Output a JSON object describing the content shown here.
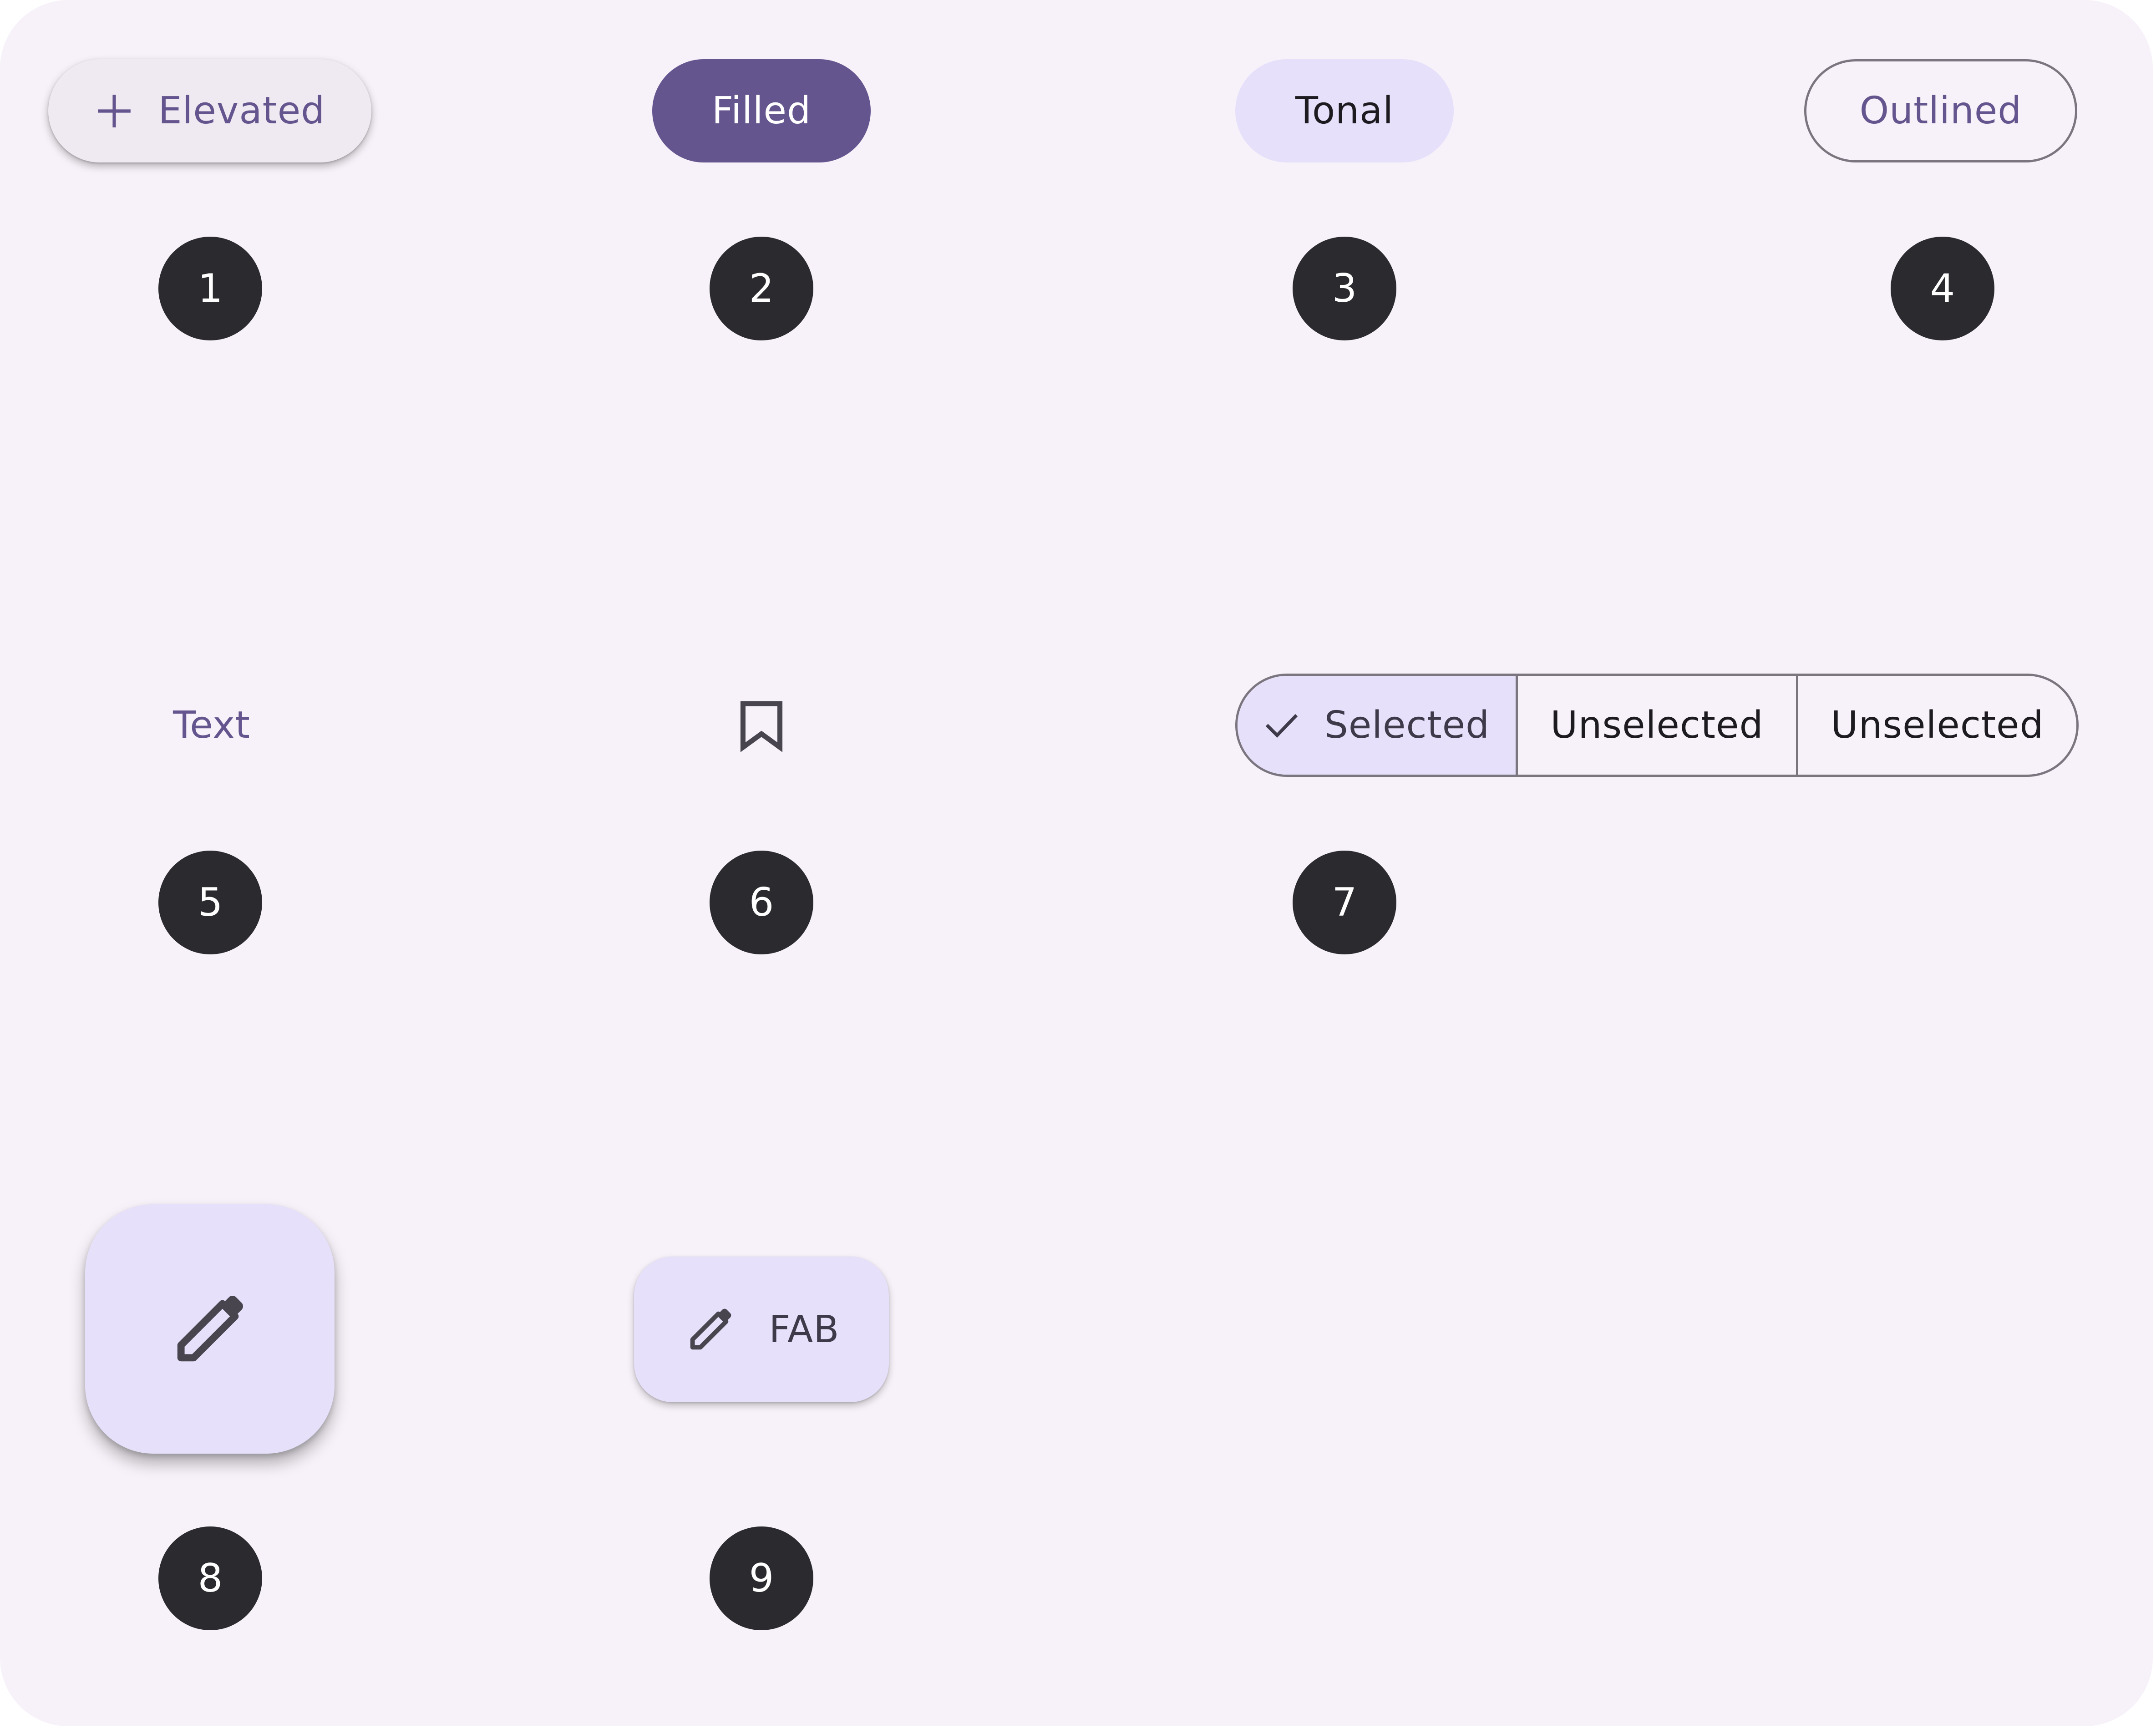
{
  "buttons": {
    "elevated": {
      "label": "Elevated",
      "icon": "plus-icon"
    },
    "filled": {
      "label": "Filled"
    },
    "tonal": {
      "label": "Tonal"
    },
    "outlined": {
      "label": "Outlined"
    },
    "text": {
      "label": "Text"
    },
    "icon": {
      "icon": "bookmark-icon"
    }
  },
  "segmented": {
    "items": [
      {
        "label": "Selected",
        "selected": true,
        "icon": "check-icon"
      },
      {
        "label": "Unselected",
        "selected": false
      },
      {
        "label": "Unselected",
        "selected": false
      }
    ]
  },
  "fab": {
    "icon": "pencil-icon"
  },
  "extended_fab": {
    "label": "FAB",
    "icon": "pencil-icon"
  },
  "badges": [
    "1",
    "2",
    "3",
    "4",
    "5",
    "6",
    "7",
    "8",
    "9"
  ],
  "colors": {
    "background": "#f7f2f9",
    "primary": "#65558f",
    "tonal_container": "#e6e0fa",
    "outline": "#7a757f",
    "badge": "#2b2a2e"
  }
}
